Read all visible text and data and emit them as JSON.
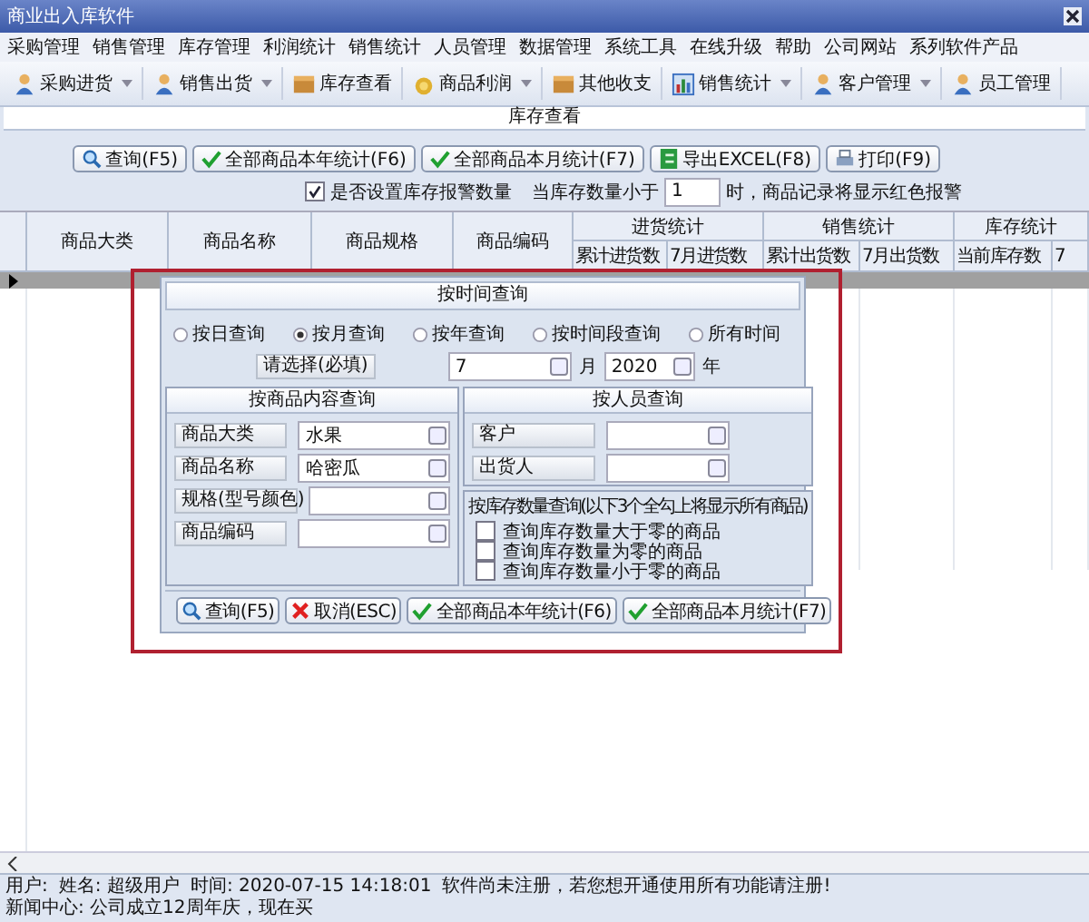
{
  "window": {
    "title": "商业出入库软件"
  },
  "menu": [
    "采购管理",
    "销售管理",
    "库存管理",
    "利润统计",
    "销售统计",
    "人员管理",
    "数据管理",
    "系统工具",
    "在线升级",
    "帮助",
    "公司网站",
    "系列软件产品"
  ],
  "toolbar": [
    {
      "label": "采购进货",
      "kind": "person",
      "dropdown": true
    },
    {
      "label": "销售出货",
      "kind": "person",
      "dropdown": true
    },
    {
      "label": "库存查看",
      "kind": "box",
      "dropdown": false
    },
    {
      "label": "商品利润",
      "kind": "coin",
      "dropdown": true
    },
    {
      "label": "其他收支",
      "kind": "box",
      "dropdown": false
    },
    {
      "label": "销售统计",
      "kind": "chart",
      "dropdown": true
    },
    {
      "label": "客户管理",
      "kind": "person",
      "dropdown": true
    },
    {
      "label": "员工管理",
      "kind": "person",
      "dropdown": false
    }
  ],
  "section_title": "库存查看",
  "actions": [
    {
      "label": "查询(F5)",
      "kind": "search"
    },
    {
      "label": "全部商品本年统计(F6)",
      "kind": "check"
    },
    {
      "label": "全部商品本月统计(F7)",
      "kind": "check"
    },
    {
      "label": "导出EXCEL(F8)",
      "kind": "sheet"
    },
    {
      "label": "打印(F9)",
      "kind": "printer"
    }
  ],
  "alert": {
    "checked": true,
    "label": "是否设置库存报警数量",
    "prefix": "当库存数量小于",
    "value": "1",
    "suffix": "时，商品记录将显示红色报警"
  },
  "table": {
    "columns": [
      {
        "label": "商品大类"
      },
      {
        "label": "商品名称"
      },
      {
        "label": "商品规格"
      },
      {
        "label": "商品编码"
      },
      {
        "label": "进货统计",
        "children": [
          "累计进货数",
          "7月进货数"
        ]
      },
      {
        "label": "销售统计",
        "children": [
          "累计出货数",
          "7月出货数"
        ]
      },
      {
        "label": "库存统计",
        "children": [
          "当前库存数",
          "7"
        ]
      }
    ]
  },
  "dialog": {
    "title": "按时间查询",
    "radios": [
      {
        "label": "按日查询",
        "selected": false
      },
      {
        "label": "按月查询",
        "selected": true
      },
      {
        "label": "按年查询",
        "selected": false
      },
      {
        "label": "按时间段查询",
        "selected": false
      },
      {
        "label": "所有时间",
        "selected": false
      }
    ],
    "required_label": "请选择(必填)",
    "month": "7",
    "month_unit": "月",
    "year": "2020",
    "year_unit": "年",
    "product": {
      "title": "按商品内容查询",
      "fields": [
        {
          "label": "商品大类",
          "value": "水果"
        },
        {
          "label": "商品名称",
          "value": "哈密瓜"
        },
        {
          "label": "规格(型号颜色)"
        },
        {
          "label": "商品编码"
        }
      ]
    },
    "person": {
      "title": "按人员查询",
      "fields": [
        {
          "label": "客户"
        },
        {
          "label": "出货人"
        }
      ]
    },
    "stock": {
      "title": "按库存数量查询(以下3个全勾上将显示所有商品)",
      "checks": [
        {
          "label": "查询库存数量大于零的商品",
          "checked": false
        },
        {
          "label": "查询库存数量为零的商品",
          "checked": false
        },
        {
          "label": "查询库存数量小于零的商品",
          "checked": false
        }
      ]
    },
    "buttons": [
      {
        "label": "查询(F5)",
        "kind": "search"
      },
      {
        "label": "取消(ESC)",
        "kind": "cross"
      },
      {
        "label": "全部商品本年统计(F6)",
        "kind": "check"
      },
      {
        "label": "全部商品本月统计(F7)",
        "kind": "check"
      }
    ]
  },
  "status_bar": [
    "用户:",
    "姓名: 超级用户",
    "时间: 2020-07-15 14:18:01",
    "软件尚未注册，若您想开通使用所有功能请注册!",
    "新闻中心: 公司成立12周年庆，现在买"
  ]
}
